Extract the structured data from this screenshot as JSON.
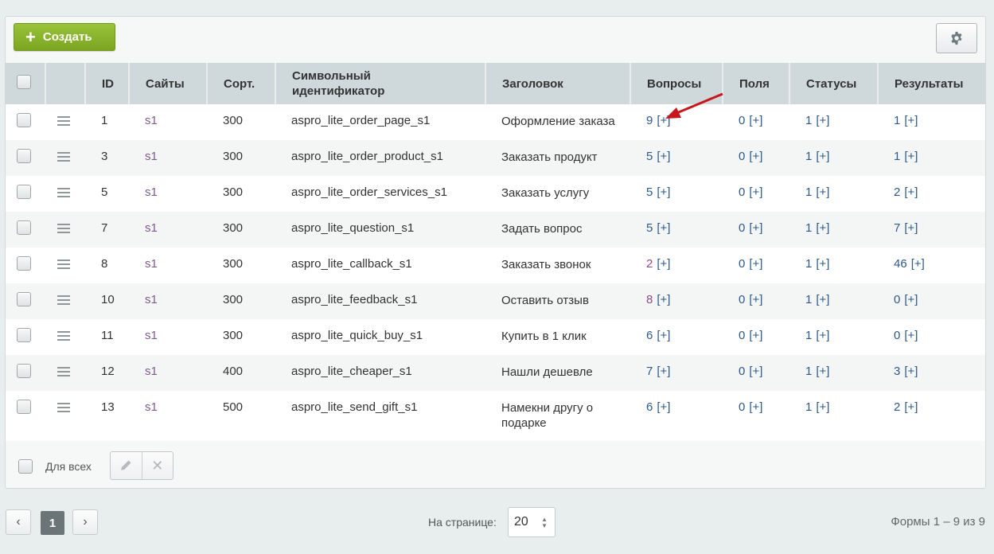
{
  "toolbar": {
    "create_label": "Создать"
  },
  "table": {
    "headers": {
      "id": "ID",
      "sites": "Сайты",
      "sort": "Сорт.",
      "code_line1": "Символьный",
      "code_line2": "идентификатор",
      "title": "Заголовок",
      "questions": "Вопросы",
      "fields": "Поля",
      "statuses": "Статусы",
      "results": "Результаты"
    },
    "add_label": "[+]",
    "rows": [
      {
        "id": "1",
        "site": "s1",
        "sort": "300",
        "code": "aspro_lite_order_page_s1",
        "title": "Оформление заказа",
        "questions": "9",
        "fields": "0",
        "statuses": "1",
        "results": "1"
      },
      {
        "id": "3",
        "site": "s1",
        "sort": "300",
        "code": "aspro_lite_order_product_s1",
        "title": "Заказать продукт",
        "questions": "5",
        "fields": "0",
        "statuses": "1",
        "results": "1"
      },
      {
        "id": "5",
        "site": "s1",
        "sort": "300",
        "code": "aspro_lite_order_services_s1",
        "title": "Заказать услугу",
        "questions": "5",
        "fields": "0",
        "statuses": "1",
        "results": "2"
      },
      {
        "id": "7",
        "site": "s1",
        "sort": "300",
        "code": "aspro_lite_question_s1",
        "title": "Задать вопрос",
        "questions": "5",
        "fields": "0",
        "statuses": "1",
        "results": "7"
      },
      {
        "id": "8",
        "site": "s1",
        "sort": "300",
        "code": "aspro_lite_callback_s1",
        "title": "Заказать звонок",
        "questions": "2",
        "fields": "0",
        "statuses": "1",
        "results": "46"
      },
      {
        "id": "10",
        "site": "s1",
        "sort": "300",
        "code": "aspro_lite_feedback_s1",
        "title": "Оставить отзыв",
        "questions": "8",
        "fields": "0",
        "statuses": "1",
        "results": "0"
      },
      {
        "id": "11",
        "site": "s1",
        "sort": "300",
        "code": "aspro_lite_quick_buy_s1",
        "title": "Купить в 1 клик",
        "questions": "6",
        "fields": "0",
        "statuses": "1",
        "results": "0"
      },
      {
        "id": "12",
        "site": "s1",
        "sort": "400",
        "code": "aspro_lite_cheaper_s1",
        "title": "Нашли дешевле",
        "questions": "7",
        "fields": "0",
        "statuses": "1",
        "results": "3"
      },
      {
        "id": "13",
        "site": "s1",
        "sort": "500",
        "code": "aspro_lite_send_gift_s1",
        "title": "Намекни другу о подарке",
        "questions": "6",
        "fields": "0",
        "statuses": "1",
        "results": "2"
      }
    ]
  },
  "footer": {
    "for_all_label": "Для всех"
  },
  "pager": {
    "current_page": "1",
    "per_page_label": "На странице:",
    "per_page_value": "20",
    "summary": "Формы 1 – 9 из 9"
  },
  "colors": {
    "accent_green": "#8cb82b",
    "annotation_arrow": "#c8161d"
  }
}
